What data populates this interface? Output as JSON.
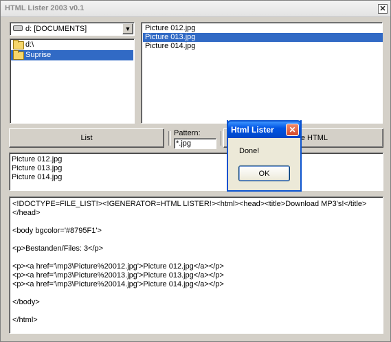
{
  "window": {
    "title": "HTML Lister 2003 v0.1",
    "close_glyph": "✕"
  },
  "drive": {
    "value": "d: [DOCUMENTS]",
    "icon": "drive-icon",
    "arrow": "▼"
  },
  "directories": [
    {
      "label": "d:\\",
      "selected": false
    },
    {
      "label": "Suprise",
      "selected": true
    }
  ],
  "files": [
    {
      "label": "Picture 012.jpg",
      "selected": false
    },
    {
      "label": "Picture 013.jpg",
      "selected": true
    },
    {
      "label": "Picture 014.jpg",
      "selected": false
    }
  ],
  "toolbar": {
    "list_label": "List",
    "pattern_label": "Pattern:",
    "pattern_value": "*.jpg",
    "html_label": "e HTML"
  },
  "results": [
    "Picture 012.jpg",
    "Picture 013.jpg",
    "Picture 014.jpg"
  ],
  "source_lines": [
    "<!DOCTYPE=FILE_LIST!><!GENERATOR=HTML LISTER!><html><head><title>Download MP3's!</title>",
    "</head>",
    "",
    "<body bgcolor='#8795F1'>",
    "",
    "<p>Bestanden/Files: 3</p>",
    "",
    "<p><a href='\\mp3\\Picture%20012.jpg'>Picture 012.jpg</a></p>",
    "<p><a href='\\mp3\\Picture%20013.jpg'>Picture 013.jpg</a></p>",
    "<p><a href='\\mp3\\Picture%20014.jpg'>Picture 014.jpg</a></p>",
    "",
    "</body>",
    "",
    "</html>"
  ],
  "dialog": {
    "title": "Html Lister",
    "message": "Done!",
    "ok_label": "OK",
    "close_glyph": "✕"
  },
  "colors": {
    "selection": "#316ac5",
    "dialog_title": "#0054e3"
  }
}
